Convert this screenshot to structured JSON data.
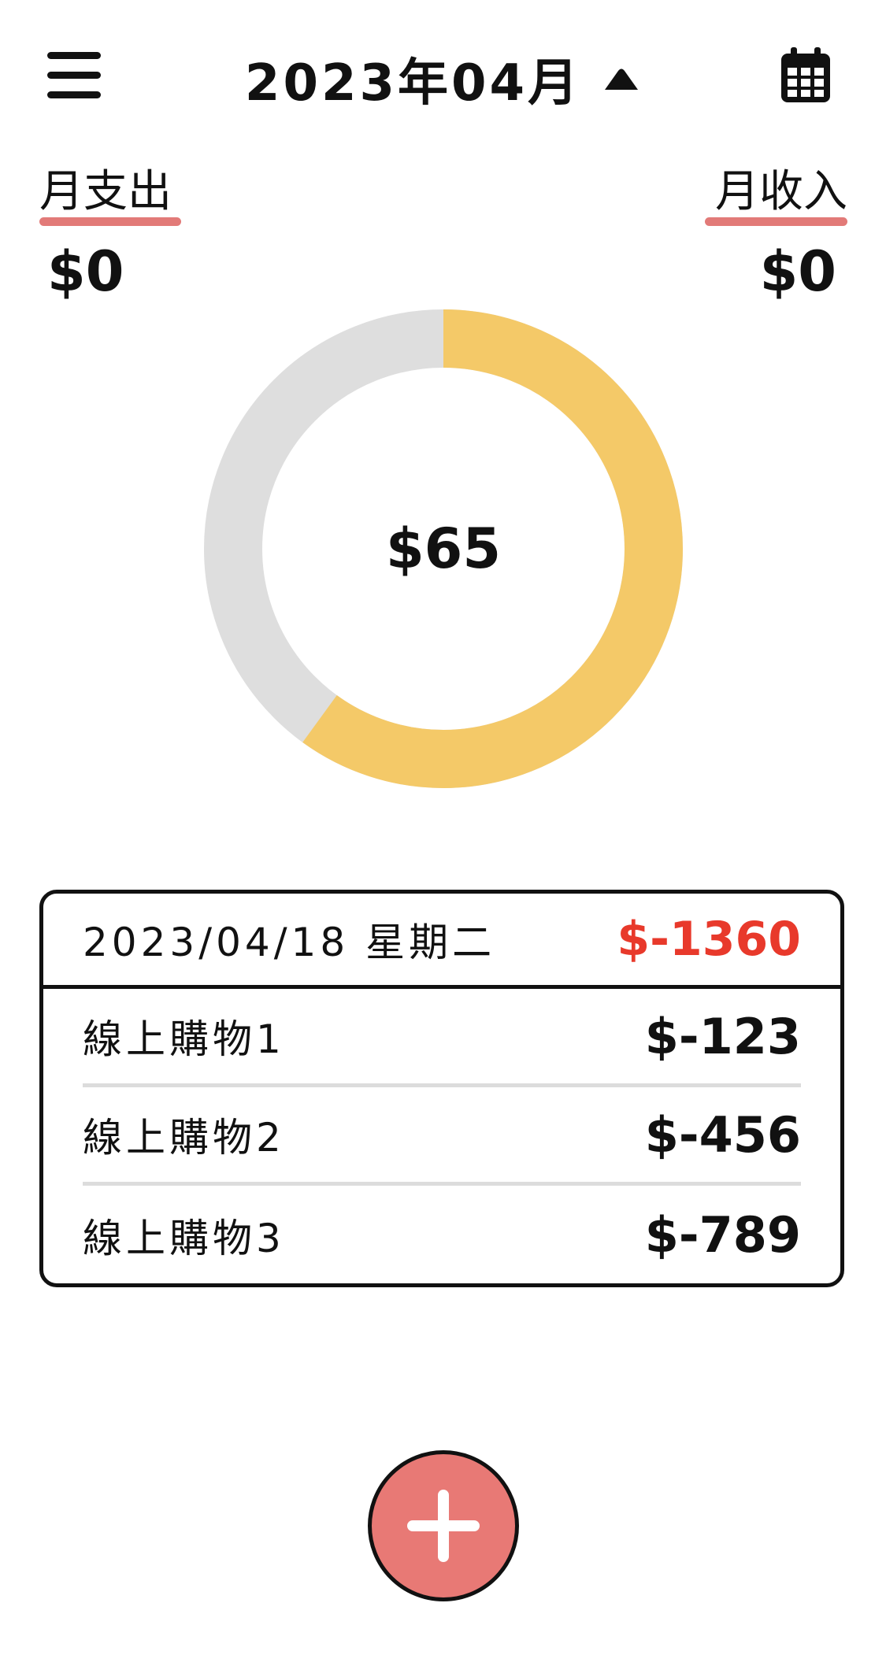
{
  "header": {
    "title": "2023年04月",
    "menu_icon": "hamburger-menu-icon",
    "dropdown_icon": "caret-up-icon",
    "calendar_icon": "calendar-icon"
  },
  "summary": {
    "expense_label": "月支出",
    "expense_value": "$0",
    "income_label": "月收入",
    "income_value": "$0",
    "underline_color": "#e27a78"
  },
  "donut": {
    "center_value": "$65",
    "track_color": "#dedede",
    "fill_color": "#f4c968",
    "filled_fraction": 0.6
  },
  "day_card": {
    "date": "2023/04/18 星期二",
    "total": "$-1360",
    "total_color": "#e8392b",
    "items": [
      {
        "name": "線上購物1",
        "amount": "$-123"
      },
      {
        "name": "線上購物2",
        "amount": "$-456"
      },
      {
        "name": "線上購物3",
        "amount": "$-789"
      }
    ]
  },
  "fab": {
    "icon": "plus-icon",
    "color": "#e87975"
  }
}
